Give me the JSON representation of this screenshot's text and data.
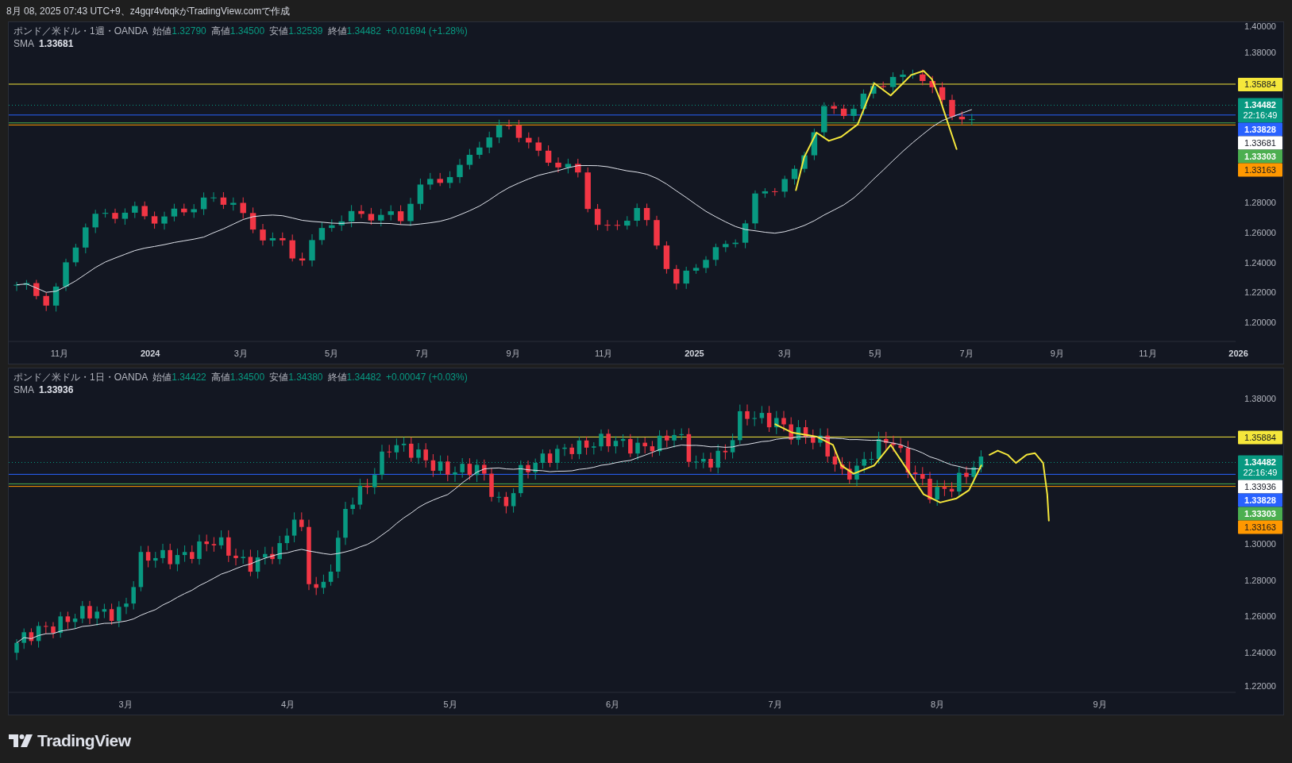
{
  "caption": "8月 08, 2025 07:43 UTC+9、z4gqr4vbqkがTradingView.comで作成",
  "panels": [
    {
      "legend": {
        "title": "ポンド／米ドル・1週・OANDA",
        "fields": [
          {
            "label": "始値",
            "value": "1.32790"
          },
          {
            "label": "高値",
            "value": "1.34500"
          },
          {
            "label": "安値",
            "value": "1.32539"
          },
          {
            "label": "終値",
            "value": "1.34482"
          }
        ],
        "change": "+0.01694 (+1.28%)",
        "indicator": {
          "name": "SMA",
          "value": "1.33681"
        }
      },
      "price_ticks": [
        "1.40000",
        "1.38000",
        "1.28000",
        "1.26000",
        "1.24000",
        "1.22000",
        "1.20000"
      ],
      "price_tags": [
        {
          "text": "1.35884",
          "color": "#f5e73b",
          "kind": "solid"
        },
        {
          "text": "1.34482",
          "subtext": "22:16:49",
          "color": "#089981",
          "kind": "dotted"
        },
        {
          "text": "1.33828",
          "color": "#2962ff",
          "kind": "solid"
        },
        {
          "text": "1.33681",
          "color": "#ffffff",
          "kind": "none"
        },
        {
          "text": "1.33303",
          "color": "#4caf50",
          "kind": "solid"
        },
        {
          "text": "1.33163",
          "color": "#ff9800",
          "kind": "solid"
        }
      ],
      "time_labels": [
        {
          "text": "11月",
          "kind": "month"
        },
        {
          "text": "2024",
          "kind": "year"
        },
        {
          "text": "3月",
          "kind": "month"
        },
        {
          "text": "5月",
          "kind": "month"
        },
        {
          "text": "7月",
          "kind": "month"
        },
        {
          "text": "9月",
          "kind": "month"
        },
        {
          "text": "11月",
          "kind": "month"
        },
        {
          "text": "2025",
          "kind": "year"
        },
        {
          "text": "3月",
          "kind": "month"
        },
        {
          "text": "5月",
          "kind": "month"
        },
        {
          "text": "7月",
          "kind": "month"
        },
        {
          "text": "9月",
          "kind": "month"
        },
        {
          "text": "11月",
          "kind": "month"
        },
        {
          "text": "2026",
          "kind": "year"
        }
      ]
    },
    {
      "legend": {
        "title": "ポンド／米ドル・1日・OANDA",
        "fields": [
          {
            "label": "始値",
            "value": "1.34422"
          },
          {
            "label": "高値",
            "value": "1.34500"
          },
          {
            "label": "安値",
            "value": "1.34380"
          },
          {
            "label": "終値",
            "value": "1.34482"
          }
        ],
        "change": "+0.00047 (+0.03%)",
        "indicator": {
          "name": "SMA",
          "value": "1.33936"
        }
      },
      "price_ticks": [
        "1.38000",
        "1.30000",
        "1.28000",
        "1.26000",
        "1.24000",
        "1.22000"
      ],
      "price_tags": [
        {
          "text": "1.35884",
          "color": "#f5e73b",
          "kind": "solid"
        },
        {
          "text": "1.34482",
          "subtext": "22:16:49",
          "color": "#089981",
          "kind": "dotted"
        },
        {
          "text": "1.33936",
          "color": "#ffffff",
          "kind": "none"
        },
        {
          "text": "1.33828",
          "color": "#2962ff",
          "kind": "solid"
        },
        {
          "text": "1.33303",
          "color": "#4caf50",
          "kind": "solid"
        },
        {
          "text": "1.33163",
          "color": "#ff9800",
          "kind": "solid"
        }
      ],
      "time_labels": [
        {
          "text": "3月",
          "kind": "month"
        },
        {
          "text": "4月",
          "kind": "month"
        },
        {
          "text": "5月",
          "kind": "month"
        },
        {
          "text": "6月",
          "kind": "month"
        },
        {
          "text": "7月",
          "kind": "month"
        },
        {
          "text": "8月",
          "kind": "month"
        },
        {
          "text": "9月",
          "kind": "month"
        }
      ]
    }
  ],
  "brand": "TradingView"
}
